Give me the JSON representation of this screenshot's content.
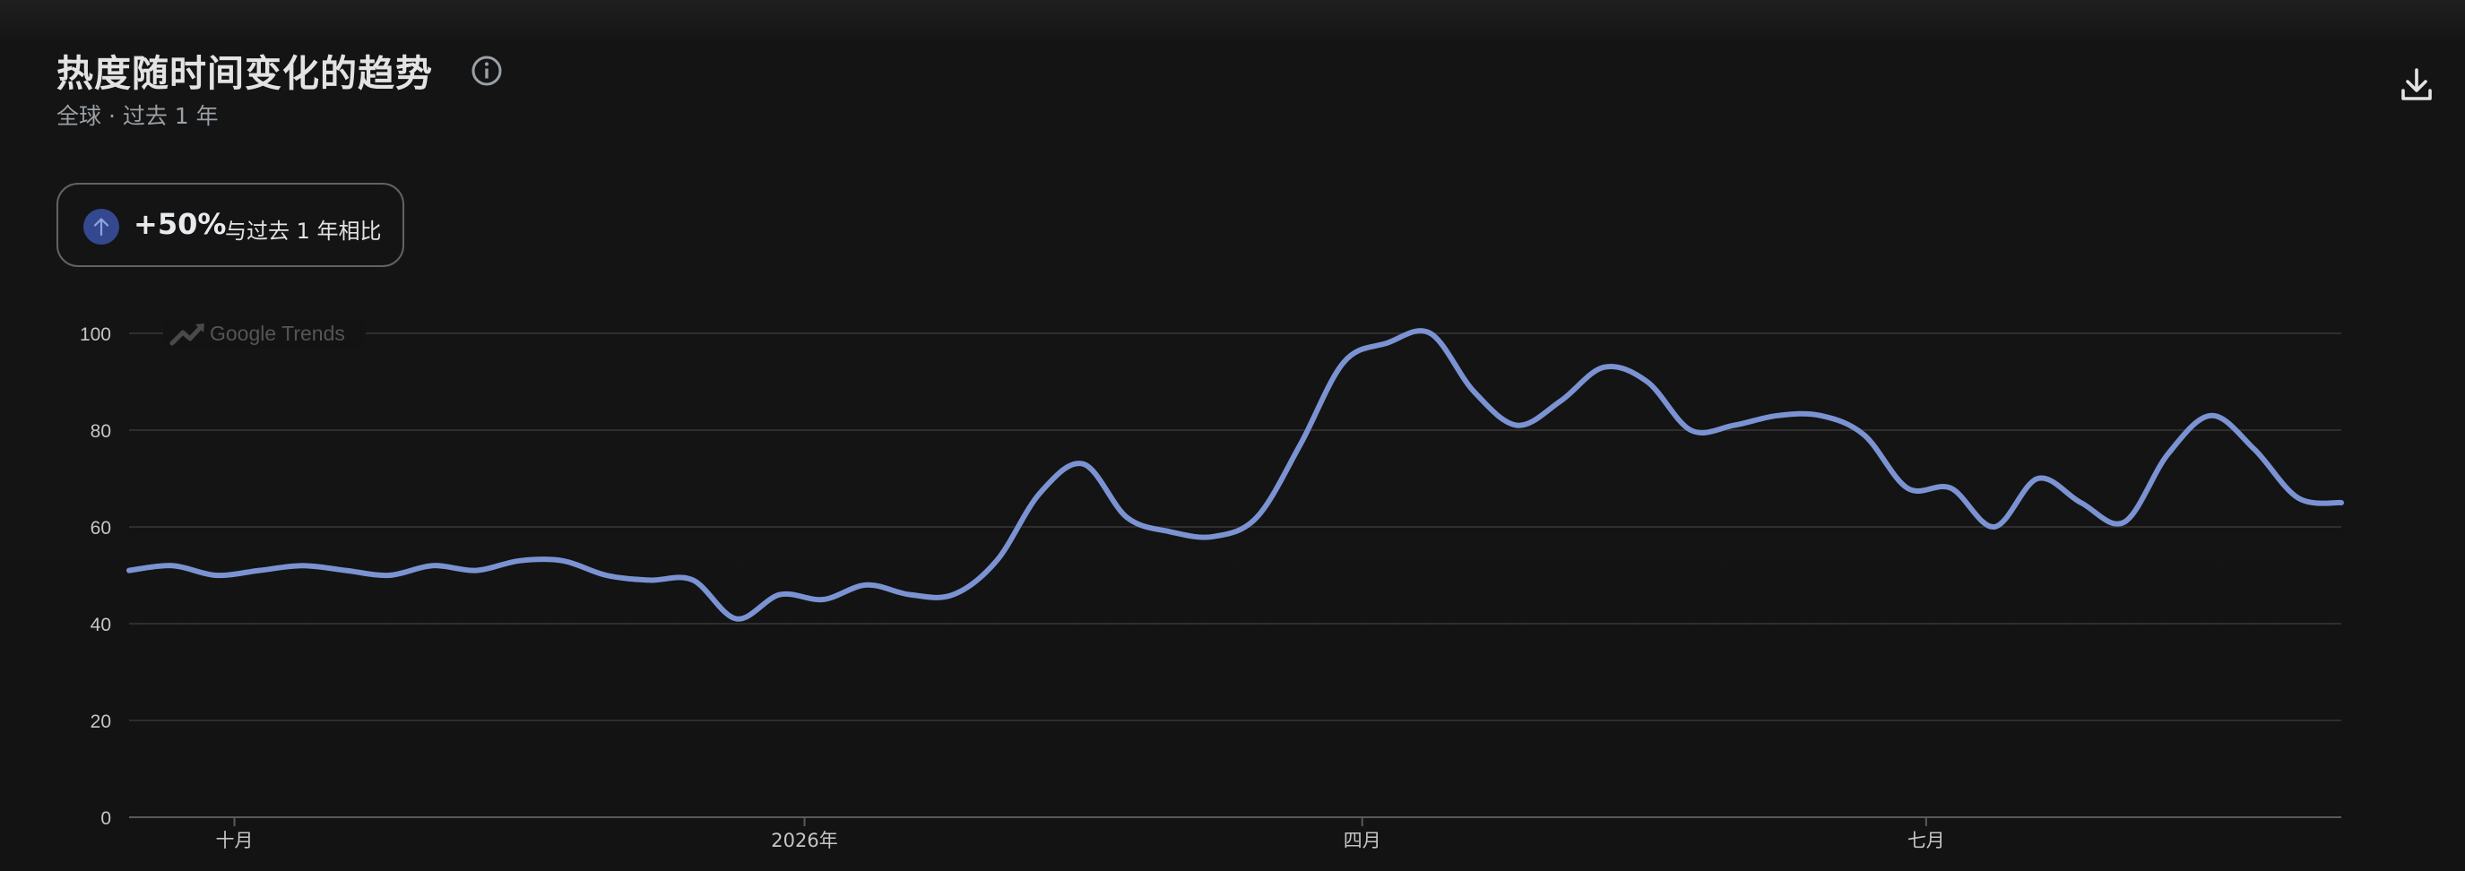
{
  "header": {
    "title": "热度随时间变化的趋势",
    "subtitle": "全球 · 过去 1 年",
    "info_icon": "info-icon",
    "download_icon": "download-icon"
  },
  "change": {
    "value": "+50%",
    "label": "与过去 1 年相比",
    "icon": "arrow-up-icon",
    "icon_color": "#34488f"
  },
  "watermark": "Google Trends",
  "colors": {
    "line": "#7b93d3",
    "grid": "#2e2e2e",
    "axis": "#5a5a5a",
    "background": "#131313"
  },
  "chart_data": {
    "type": "line",
    "title": "热度随时间变化的趋势",
    "ylim": [
      0,
      100
    ],
    "yticks": [
      0,
      20,
      40,
      60,
      80,
      100
    ],
    "grid": true,
    "xticks": [
      {
        "label": "十月",
        "x": "2025-10-01"
      },
      {
        "label": "2026年",
        "x": "2026-01-01"
      },
      {
        "label": "四月",
        "x": "2026-04-01"
      },
      {
        "label": "七月",
        "x": "2026-07-01"
      }
    ],
    "x": [
      "2025-09-14",
      "2025-09-21",
      "2025-09-28",
      "2025-10-05",
      "2025-10-12",
      "2025-10-19",
      "2025-10-26",
      "2025-11-02",
      "2025-11-09",
      "2025-11-16",
      "2025-11-23",
      "2025-11-30",
      "2025-12-07",
      "2025-12-14",
      "2025-12-21",
      "2025-12-28",
      "2026-01-04",
      "2026-01-11",
      "2026-01-18",
      "2026-01-25",
      "2026-02-01",
      "2026-02-08",
      "2026-02-15",
      "2026-02-22",
      "2026-03-01",
      "2026-03-08",
      "2026-03-15",
      "2026-03-22",
      "2026-03-29",
      "2026-04-05",
      "2026-04-12",
      "2026-04-19",
      "2026-04-26",
      "2026-05-03",
      "2026-05-10",
      "2026-05-17",
      "2026-05-24",
      "2026-05-31",
      "2026-06-07",
      "2026-06-14",
      "2026-06-21",
      "2026-06-28",
      "2026-07-05",
      "2026-07-12",
      "2026-07-19",
      "2026-07-26",
      "2026-08-02",
      "2026-08-09",
      "2026-08-16",
      "2026-08-23",
      "2026-08-30",
      "2026-09-06"
    ],
    "series": [
      {
        "values": [
          51,
          52,
          50,
          51,
          52,
          51,
          50,
          52,
          51,
          53,
          53,
          50,
          49,
          49,
          41,
          46,
          45,
          48,
          46,
          46,
          53,
          67,
          73,
          62,
          59,
          58,
          62,
          77,
          94,
          98,
          100,
          88,
          81,
          86,
          93,
          90,
          80,
          81,
          83,
          83,
          79,
          68,
          68,
          60,
          70,
          65,
          61,
          75,
          83,
          76,
          66,
          65
        ]
      }
    ]
  }
}
